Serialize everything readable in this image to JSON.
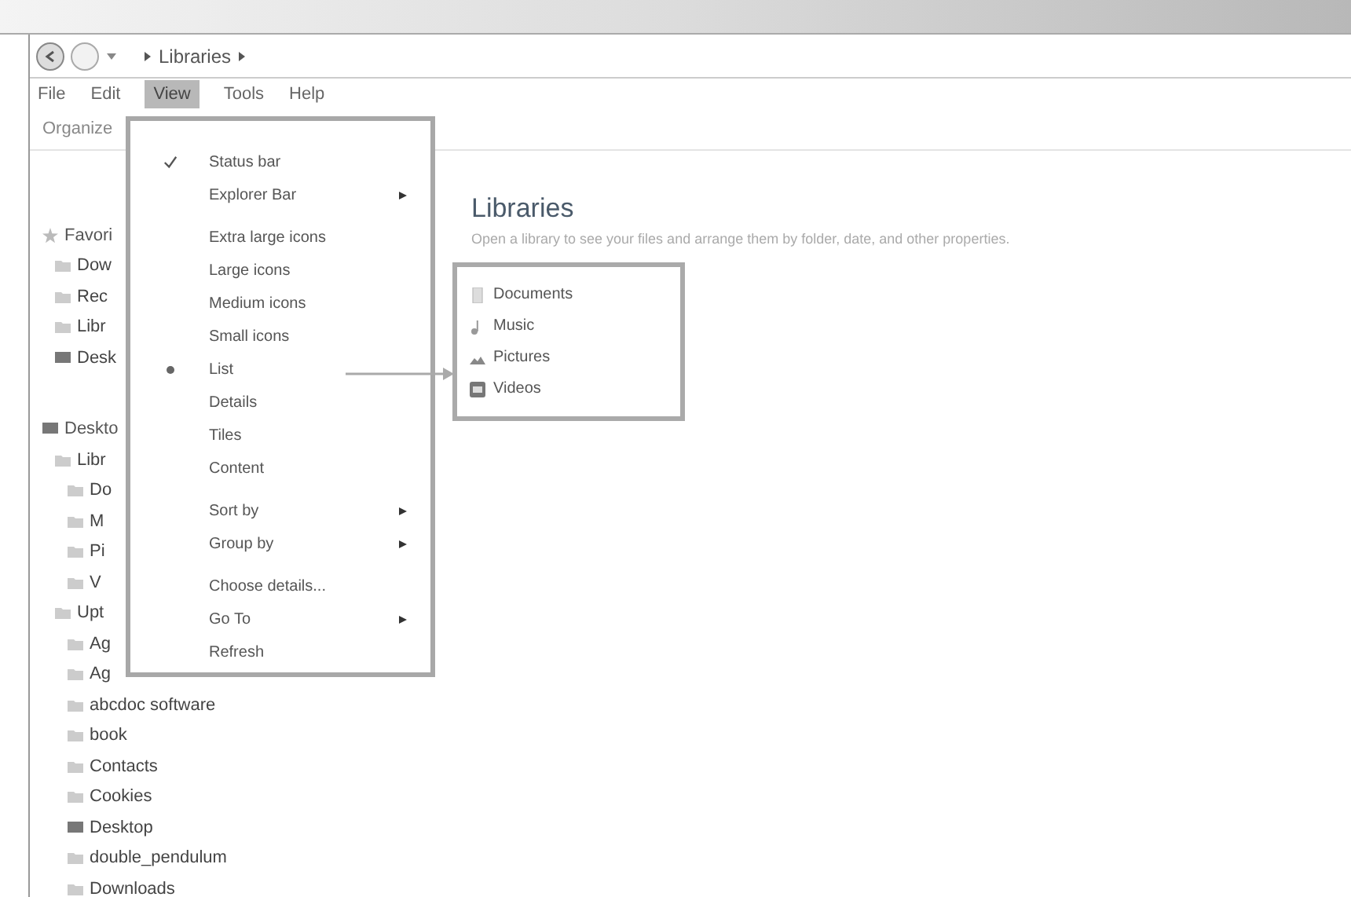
{
  "address": {
    "path": [
      "Libraries"
    ]
  },
  "menubar": [
    {
      "label": "File",
      "selected": false
    },
    {
      "label": "Edit",
      "selected": false
    },
    {
      "label": "View",
      "selected": true
    },
    {
      "label": "Tools",
      "selected": false
    },
    {
      "label": "Help",
      "selected": false
    }
  ],
  "toolbar": {
    "organize": "Organize"
  },
  "navigation": [
    {
      "label": "Favori",
      "kind": "star",
      "children": [
        {
          "label": "Dow",
          "kind": "folder"
        },
        {
          "label": "Rec",
          "kind": "folder"
        },
        {
          "label": "Libr",
          "kind": "folder"
        },
        {
          "label": "Desk",
          "kind": "desktop"
        }
      ]
    },
    {
      "label": "Deskto",
      "kind": "desktop",
      "children": [
        {
          "label": "Libr",
          "kind": "folder",
          "children": [
            {
              "label": "Do",
              "kind": "folder"
            },
            {
              "label": "M",
              "kind": "folder"
            },
            {
              "label": "Pi",
              "kind": "folder"
            },
            {
              "label": "V",
              "kind": "folder"
            }
          ]
        },
        {
          "label": "Upt",
          "kind": "folder",
          "children": [
            {
              "label": "Ag",
              "kind": "folder"
            },
            {
              "label": "Ag",
              "kind": "folder"
            },
            {
              "label": "abcdoc software",
              "kind": "folder"
            },
            {
              "label": "book",
              "kind": "folder"
            },
            {
              "label": "Contacts",
              "kind": "folder"
            },
            {
              "label": "Cookies",
              "kind": "folder"
            },
            {
              "label": "Desktop",
              "kind": "desktop"
            },
            {
              "label": "double_pendulum",
              "kind": "folder"
            },
            {
              "label": "Downloads",
              "kind": "folder"
            }
          ]
        }
      ]
    }
  ],
  "view_menu": [
    {
      "kind": "check",
      "label": "Status bar",
      "checked": true
    },
    {
      "kind": "submenu",
      "label": "Explorer Bar"
    },
    {
      "kind": "separator"
    },
    {
      "kind": "radio",
      "label": "Extra large icons",
      "checked": false
    },
    {
      "kind": "radio",
      "label": "Large icons",
      "checked": false
    },
    {
      "kind": "radio",
      "label": "Medium icons",
      "checked": false
    },
    {
      "kind": "radio",
      "label": "Small icons",
      "checked": false
    },
    {
      "kind": "radio",
      "label": "List",
      "checked": true
    },
    {
      "kind": "radio",
      "label": "Details",
      "checked": false
    },
    {
      "kind": "radio",
      "label": "Tiles",
      "checked": false
    },
    {
      "kind": "radio",
      "label": "Content",
      "checked": false
    },
    {
      "kind": "separator"
    },
    {
      "kind": "submenu",
      "label": "Sort by"
    },
    {
      "kind": "submenu",
      "label": "Group by"
    },
    {
      "kind": "separator"
    },
    {
      "kind": "plain",
      "label": "Choose details..."
    },
    {
      "kind": "submenu",
      "label": "Go To"
    },
    {
      "kind": "plain",
      "label": "Refresh"
    }
  ],
  "content": {
    "title": "Libraries",
    "description": "Open a library to see your files and arrange them by folder, date, and other properties.",
    "libraries": [
      {
        "name": "Documents",
        "kind": "documents"
      },
      {
        "name": "Music",
        "kind": "music"
      },
      {
        "name": "Pictures",
        "kind": "pictures"
      },
      {
        "name": "Videos",
        "kind": "videos"
      }
    ]
  }
}
